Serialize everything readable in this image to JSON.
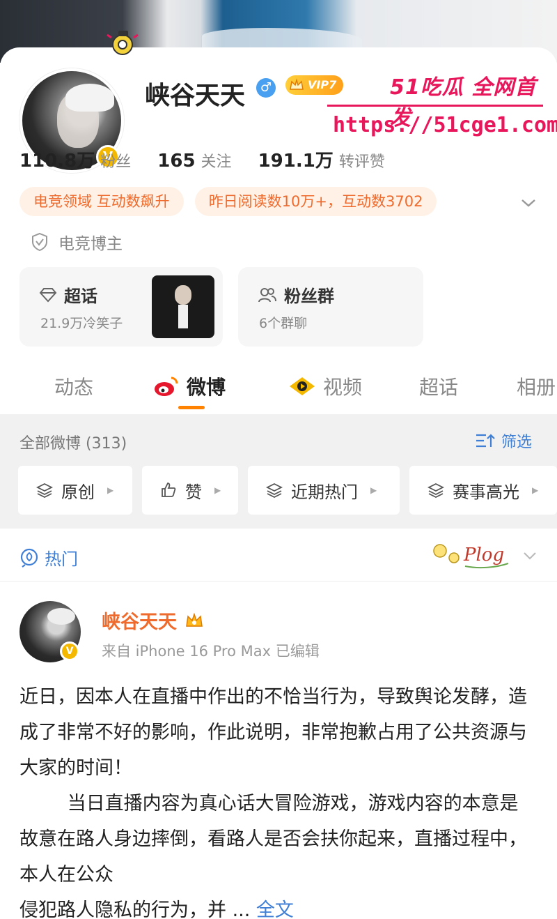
{
  "profile": {
    "name": "峡谷天天",
    "vip_label": "VIP7",
    "verified_mark": "V",
    "gender_mark": "♂",
    "stats": [
      {
        "value": "110.8万",
        "label": "粉丝"
      },
      {
        "value": "165",
        "label": "关注"
      },
      {
        "value": "191.1万",
        "label": "转评赞"
      }
    ],
    "tags": [
      "电竞领域 互动数飙升",
      "昨日阅读数10万+，互动数3702"
    ],
    "certification": "电竞博主",
    "cards": [
      {
        "title": "超话",
        "subtitle": "21.9万冷笑子",
        "icon": "diamond-icon"
      },
      {
        "title": "粉丝群",
        "subtitle": "6个群聊",
        "icon": "group-icon"
      }
    ]
  },
  "watermark": {
    "title": "51吃瓜 全网首发",
    "url": "https://51cge1.com"
  },
  "tabs": [
    {
      "label": "动态",
      "icon": null
    },
    {
      "label": "微博",
      "icon": "weibo-icon"
    },
    {
      "label": "视频",
      "icon": "video-icon"
    },
    {
      "label": "超话",
      "icon": null
    },
    {
      "label": "相册",
      "icon": null
    }
  ],
  "filter": {
    "all_label": "全部微博 (313)",
    "sift_label": "筛选",
    "chips": [
      {
        "label": "原创",
        "icon": "layers-icon"
      },
      {
        "label": "赞",
        "icon": "thumb-up-icon"
      },
      {
        "label": "近期热门",
        "icon": "layers-icon"
      },
      {
        "label": "赛事高光",
        "icon": "layers-icon"
      }
    ]
  },
  "hot": {
    "label": "热门",
    "sticker_text": "Plog"
  },
  "post": {
    "author": "峡谷天天",
    "meta": "来自 iPhone 16 Pro Max  已编辑",
    "body": "近日，因本人在直播中作出的不恰当行为，导致舆论发酵，造成了非常不好的影响，作此说明，非常抱歉占用了公共资源与大家的时间！\n        当日直播内容为真心话大冒险游戏，游戏内容的本意是故意在路人身边摔倒，看路人是否会扶你起来，直播过程中，本人在公众\n侵犯路人隐私的行为，并 ... ",
    "expand_label": "全文"
  },
  "colors": {
    "accent_orange": "#ff8200",
    "tag_text": "#ef6b2d",
    "link_blue": "#3f7fd6",
    "watermark_red": "#e8165a"
  }
}
